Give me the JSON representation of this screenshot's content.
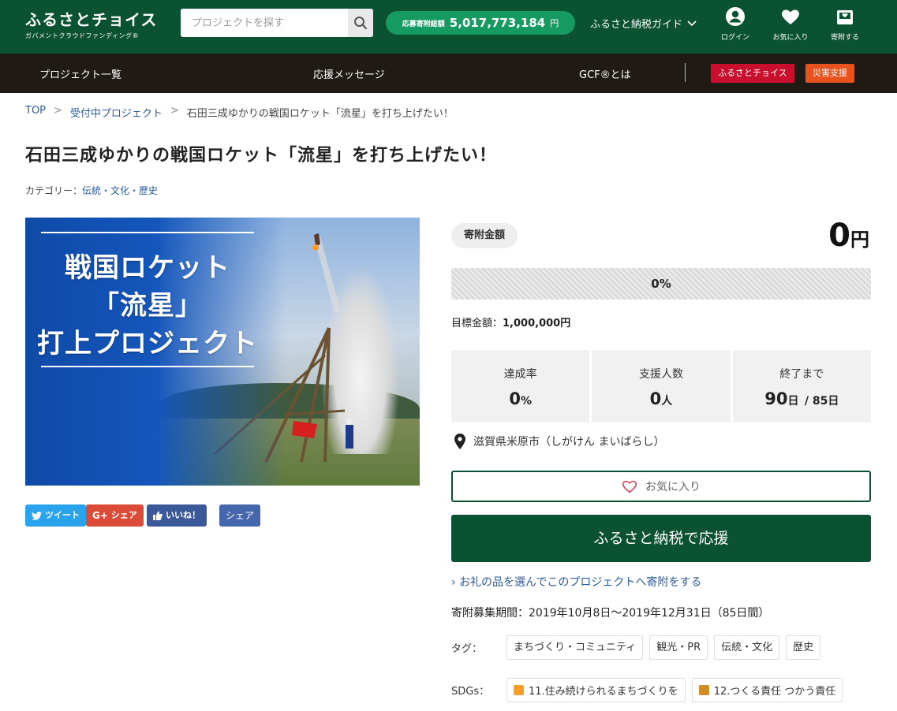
{
  "header": {
    "logo_main": "ふるさとチョイス",
    "logo_sub": "ガバメントクラウドファンディング®",
    "search_placeholder": "プロジェクトを探す",
    "total_label": "応募寄附総額",
    "total_value": "5,017,773,184",
    "total_unit": "円",
    "guide": "ふるさと納税ガイド",
    "login": "ログイン",
    "favorites": "お気に入り",
    "donate": "寄附する"
  },
  "nav": {
    "projects": "プロジェクト一覧",
    "messages": "応援メッセージ",
    "gcf": "GCF®とは",
    "furusato_tag": "ふるさとチョイス",
    "disaster_tag": "災害支援",
    "furusato_color": "#c8102e",
    "disaster_color": "#e8531d"
  },
  "breadcrumb": {
    "top": "TOP",
    "accepting": "受付中プロジェクト",
    "current": "石田三成ゆかりの戦国ロケット「流星」を打ち上げたい！",
    "sep": ">"
  },
  "project": {
    "title": "石田三成ゆかりの戦国ロケット「流星」を打ち上げたい！",
    "category_label": "カテゴリー：",
    "category_value": "伝統・文化・歴史"
  },
  "hero": {
    "line1": "戦国ロケット",
    "line2": "「流星」",
    "line3": "打上プロジェクト"
  },
  "share": {
    "tweet": "ツイート",
    "gplus": "シェア",
    "like": "いいね！",
    "fb_share": "シェア"
  },
  "funding": {
    "badge": "寄附金額",
    "amount": "0",
    "amount_unit": "円",
    "progress_label": "0%",
    "progress_fraction": 0,
    "goal_label": "目標金額：",
    "goal_value": "1,000,000円",
    "rate_label": "達成率",
    "rate_value": "0",
    "rate_unit": "%",
    "supporters_label": "支援人数",
    "supporters_value": "0",
    "supporters_unit": "人",
    "remaining_label": "終了まで",
    "remaining_value": "90",
    "remaining_unit": "日",
    "remaining_total": "/ 85日",
    "location": "滋賀県米原市（しがけん まいばらし）",
    "favorite_button": "お気に入り",
    "support_button": "ふるさと納税で応援",
    "gift_link": "お礼の品を選んでこのプロジェクトへ寄附をする",
    "period": "寄附募集期間：2019年10月8日〜2019年12月31日（85日間）"
  },
  "tags": {
    "label": "タグ：",
    "items": [
      "まちづくり・コミュニティ",
      "観光・PR",
      "伝統・文化",
      "歴史"
    ]
  },
  "sdgs": {
    "label": "SDGs：",
    "items": [
      {
        "label": "11.住み続けられるまちづくりを",
        "color": "#f99d26"
      },
      {
        "label": "12.つくる責任 つかう責任",
        "color": "#cf8d2a"
      }
    ]
  },
  "colors": {
    "brand_green": "#0b5233",
    "total_pill": "#159a62",
    "nav_dark": "#1f1a14",
    "link_blue": "#2e5a9b"
  }
}
